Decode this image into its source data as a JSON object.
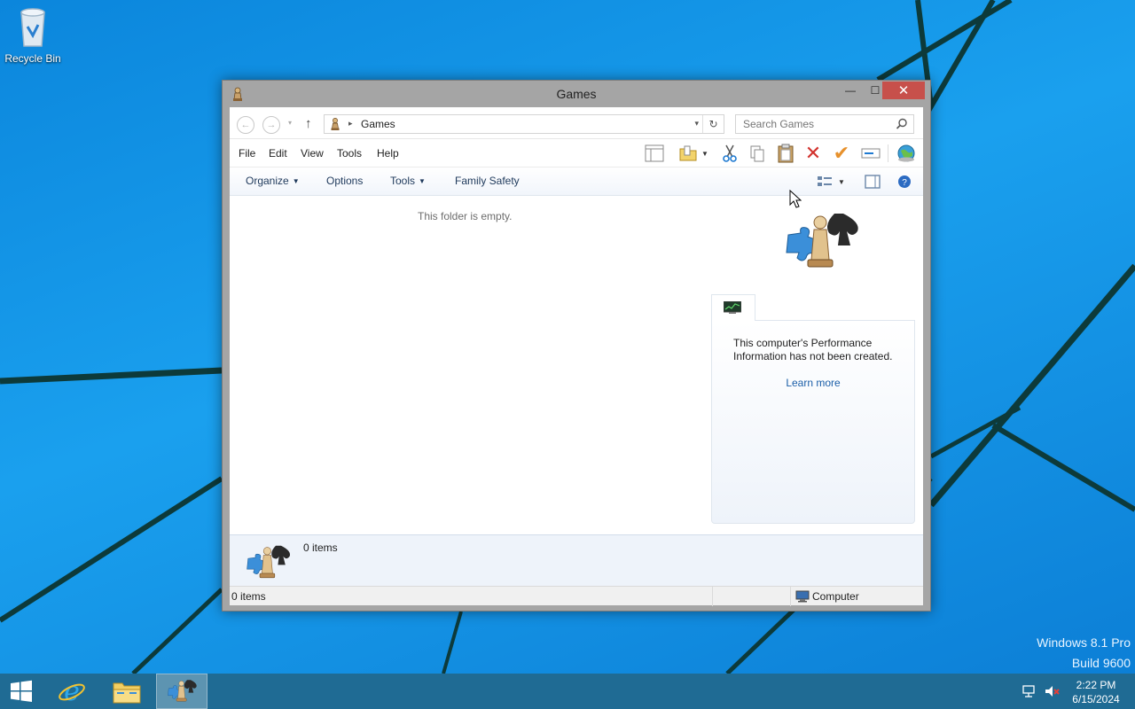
{
  "desktop": {
    "icons": [
      {
        "label": "Recycle Bin",
        "icon": "recycle-bin-icon"
      }
    ],
    "watermark": {
      "line1": "Windows 8.1 Pro",
      "line2": "Build 9600"
    }
  },
  "window": {
    "title": "Games",
    "controls": {
      "minimize": "—",
      "maximize": "☐",
      "close": "✕"
    },
    "navigation": {
      "back": "←",
      "forward": "→",
      "recent": "▾",
      "up": "↑",
      "address_separator": "▸",
      "address_path": "Games",
      "address_dropdown": "▾",
      "refresh": "↻",
      "search_placeholder": "Search Games"
    },
    "menu": [
      "File",
      "Edit",
      "View",
      "Tools",
      "Help"
    ],
    "toolbar_icons": [
      "layout-icon",
      "folder-options-icon",
      "cut-icon",
      "copy-icon",
      "paste-icon",
      "delete-icon",
      "check-icon",
      "rename-icon",
      "globe-icon"
    ],
    "commands": {
      "organize": "Organize",
      "options": "Options",
      "tools": "Tools",
      "family_safety": "Family Safety",
      "caret": "▼"
    },
    "content": {
      "empty_message": "This folder is empty.",
      "performance": {
        "text": "This computer's Performance Information has not been created.",
        "link": "Learn more"
      }
    },
    "details_pane": {
      "count": "0 items"
    },
    "status_bar": {
      "left": "0 items",
      "right": "Computer"
    }
  },
  "taskbar": {
    "pinned": [
      "internet-explorer-icon",
      "file-explorer-icon",
      "games-icon"
    ],
    "active": "games-icon",
    "clock": {
      "time": "2:22 PM",
      "date": "6/15/2024"
    }
  },
  "colors": {
    "desktop": "#1594e6",
    "taskbar": "#1f6b94",
    "close_button": "#c7504b",
    "link": "#1a5ea8"
  }
}
